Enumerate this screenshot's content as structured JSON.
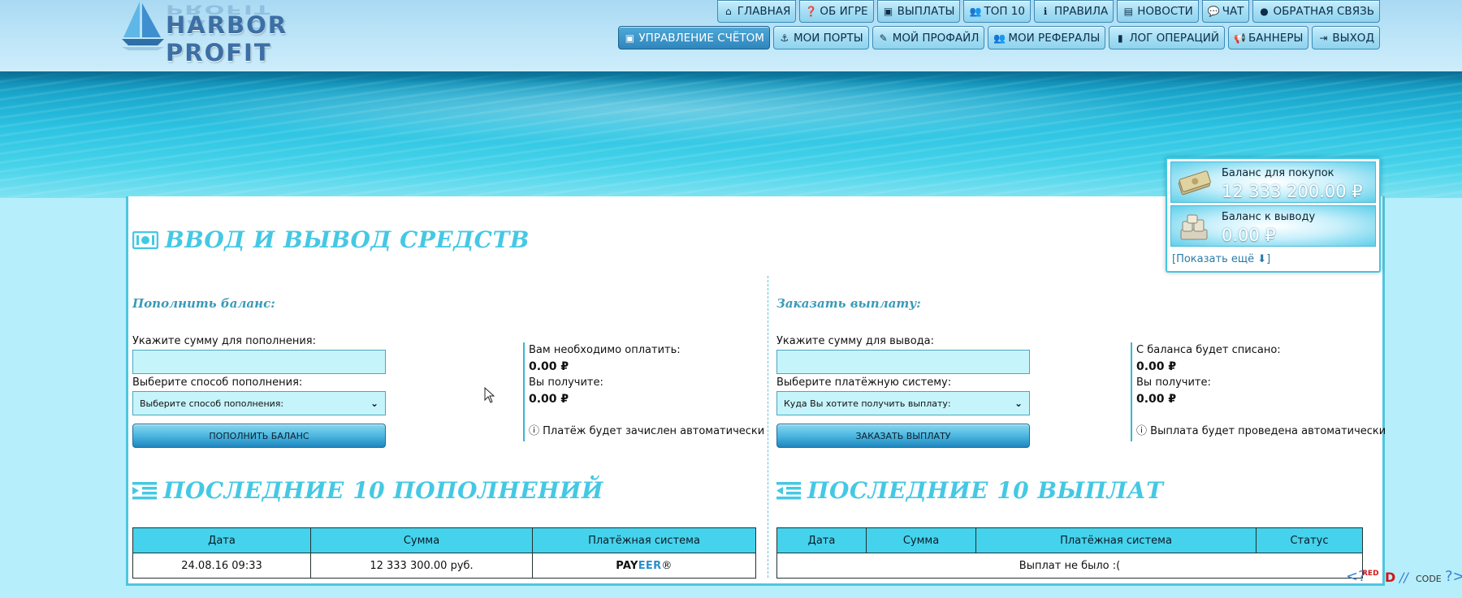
{
  "site": {
    "logo_text": "HARBOR PROFIT"
  },
  "nav": {
    "row1": [
      {
        "label": "ГЛАВНАЯ",
        "icon": "home-icon"
      },
      {
        "label": "ОБ ИГРЕ",
        "icon": "question-icon"
      },
      {
        "label": "ВЫПЛАТЫ",
        "icon": "money-icon"
      },
      {
        "label": "ТОП 10",
        "icon": "users-icon"
      },
      {
        "label": "ПРАВИЛА",
        "icon": "info-icon"
      },
      {
        "label": "НОВОСТИ",
        "icon": "file-icon"
      },
      {
        "label": "ЧАТ",
        "icon": "chat-icon"
      },
      {
        "label": "ОБРАТНАЯ СВЯЗЬ",
        "icon": "comment-icon"
      }
    ],
    "row2": [
      {
        "label": "УПРАВЛЕНИЕ СЧЁТОМ",
        "icon": "money-icon",
        "active": true
      },
      {
        "label": "МОИ ПОРТЫ",
        "icon": "anchor-icon"
      },
      {
        "label": "МОЙ ПРОФАЙЛ",
        "icon": "edit-icon"
      },
      {
        "label": "МОИ РЕФЕРАЛЫ",
        "icon": "users-icon"
      },
      {
        "label": "ЛОГ ОПЕРАЦИЙ",
        "icon": "book-icon"
      },
      {
        "label": "БАННЕРЫ",
        "icon": "bullhorn-icon"
      },
      {
        "label": "ВЫХОД",
        "icon": "sign-out-icon"
      }
    ]
  },
  "balance": {
    "buy_label": "Баланс для покупок",
    "buy_value": "12 333 200.00 ₽",
    "withdraw_label": "Баланс к выводу",
    "withdraw_value": "0.00 ₽",
    "show_more": "[Показать ещё",
    "show_more_close": "]"
  },
  "page": {
    "title": "ВВОД И ВЫВОД СРЕДСТВ"
  },
  "deposit": {
    "heading": "Пополнить баланс:",
    "amount_label": "Укажите сумму для пополнения:",
    "amount_value": "",
    "method_label": "Выберите способ пополнения:",
    "method_selected": "Выберите способ пополнения:",
    "button": "ПОПОЛНИТЬ БАЛАНС",
    "pay_label": "Вам необходимо оплатить:",
    "pay_value": "0.00 ₽",
    "receive_label": "Вы получите:",
    "receive_value": "0.00 ₽",
    "note": "Платёж будет зачислен автоматически"
  },
  "withdraw": {
    "heading": "Заказать выплату:",
    "amount_label": "Укажите сумму для вывода:",
    "amount_value": "",
    "system_label": "Выберите платёжную систему:",
    "system_selected": "Куда Вы хотите получить выплату:",
    "button": "ЗАКАЗАТЬ ВЫПЛАТУ",
    "debit_label": "С баланса будет списано:",
    "debit_value": "0.00 ₽",
    "receive_label": "Вы получите:",
    "receive_value": "0.00 ₽",
    "note": "Выплата будет проведена автоматически"
  },
  "last_deposits": {
    "title": "ПОСЛЕДНИЕ 10 ПОПОЛНЕНИЙ",
    "columns": [
      "Дата",
      "Сумма",
      "Платёжная система"
    ],
    "rows": [
      {
        "date": "24.08.16 09:33",
        "amount": "12 333 300.00 руб.",
        "system_a": "PAY",
        "system_b": "EER",
        "system_mark": "®"
      }
    ]
  },
  "last_withdrawals": {
    "title": "ПОСЛЕДНИЕ 10 ВЫПЛАТ",
    "columns": [
      "Дата",
      "Сумма",
      "Платёжная система",
      "Статус"
    ],
    "empty_text": "Выплат не было :("
  },
  "watermark": {
    "left": "RED",
    "right": "CODE"
  },
  "colors": {
    "accent": "#45c8e4",
    "header_sea": "#2cc3e2",
    "table_header": "#45d2ec",
    "input_bg": "#c6f4fb"
  }
}
